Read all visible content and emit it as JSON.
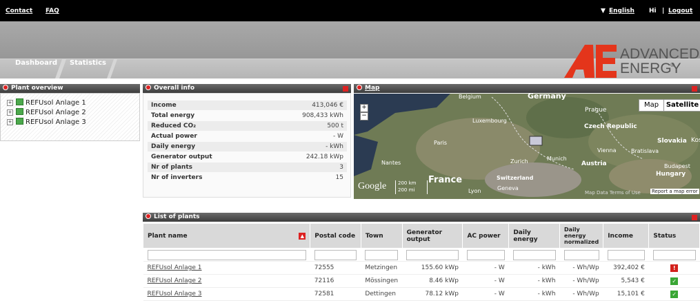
{
  "topbar": {
    "contact": "Contact",
    "faq": "FAQ",
    "language": "English",
    "greeting": "Hi",
    "separator": "|",
    "logout": "Logout"
  },
  "nav": {
    "dashboard": "Dashboard",
    "statistics": "Statistics"
  },
  "logo": {
    "line1": "ADVANCED",
    "line2": "ENERGY",
    "mark": "AE"
  },
  "plant_overview": {
    "title": "Plant overview",
    "items": [
      "REFUsol Anlage 1",
      "REFUsol Anlage 2",
      "REFUsol Anlage 3"
    ]
  },
  "overall_info": {
    "title": "Overall info",
    "rows": [
      {
        "label": "Income",
        "value": "413,046 €"
      },
      {
        "label": "Total energy",
        "value": "908,433 kWh"
      },
      {
        "label": "Reduced CO₂",
        "value": "500 t"
      },
      {
        "label": "Actual power",
        "value": "- W"
      },
      {
        "label": "Daily energy",
        "value": "- kWh"
      },
      {
        "label": "Generator output",
        "value": "242.18 kWp"
      },
      {
        "label": "Nr of plants",
        "value": "3"
      },
      {
        "label": "Nr of inverters",
        "value": "15"
      }
    ]
  },
  "map": {
    "title": "Map",
    "btn_map": "Map",
    "btn_satellite": "Satellite",
    "scale_km": "200 km",
    "scale_mi": "200 mi",
    "google": "Google",
    "attribution": "Map Data  Terms of Use",
    "report": "Report a map error",
    "labels": {
      "belgium": "Belgium",
      "germany": "Germany",
      "prague": "Prague",
      "luxembourg": "Luxembourg",
      "czech": "Czech Republic",
      "paris": "Paris",
      "slovakia": "Slovakia",
      "kosice": "Kosi",
      "vienna": "Vienna",
      "bratislava": "Bratislava",
      "nantes": "Nantes",
      "zurich": "Zurich",
      "munich": "Munich",
      "austria": "Austria",
      "budapest": "Budapest",
      "hungary": "Hungary",
      "france": "France",
      "switzerland": "Switzerland",
      "lyon": "Lyon",
      "geneva": "Geneva"
    }
  },
  "plants": {
    "title": "List of plants",
    "columns": [
      "Plant name",
      "Postal code",
      "Town",
      "Generator output",
      "AC power",
      "Daily energy",
      "Daily energy normalized",
      "Income",
      "Status"
    ],
    "rows": [
      {
        "name": "REFUsol Anlage 1",
        "postal": "72555",
        "town": "Metzingen",
        "output": "155.60 kWp",
        "ac": "- W",
        "daily": "- kWh",
        "norm": "- Wh/Wp",
        "income": "392,402 €",
        "status": "error"
      },
      {
        "name": "REFUsol Anlage 2",
        "postal": "72116",
        "town": "Mössingen",
        "output": "8.46 kWp",
        "ac": "- W",
        "daily": "- kWh",
        "norm": "- Wh/Wp",
        "income": "5,543 €",
        "status": "ok"
      },
      {
        "name": "REFUsol Anlage 3",
        "postal": "72581",
        "town": "Dettingen",
        "output": "78.12 kWp",
        "ac": "- W",
        "daily": "- kWh",
        "norm": "- Wh/Wp",
        "income": "15,101 €",
        "status": "ok"
      }
    ]
  },
  "colors": {
    "accent": "#e4351b",
    "status_ok": "#3aa635",
    "status_error": "#d3211b"
  }
}
